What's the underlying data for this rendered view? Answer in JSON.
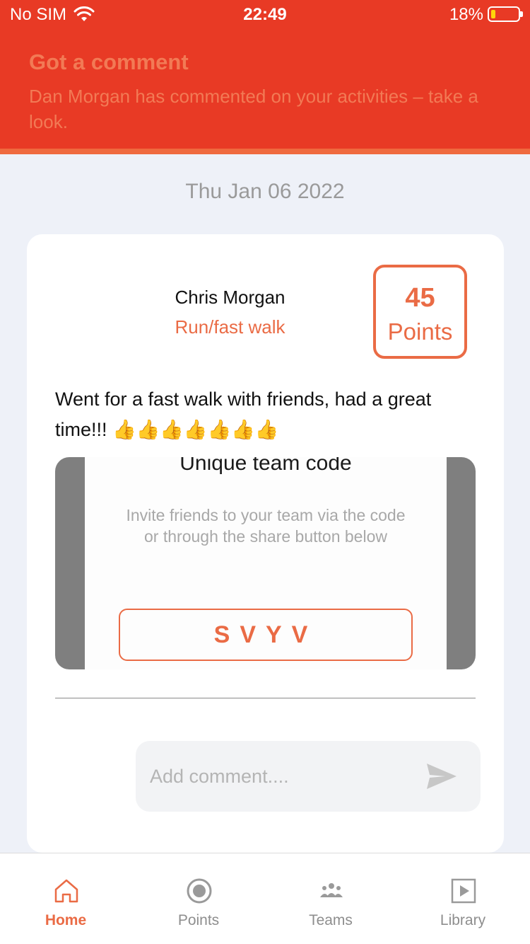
{
  "status_bar": {
    "carrier": "No SIM",
    "time": "22:49",
    "battery_percent": "18%"
  },
  "notification": {
    "title": "Got a comment",
    "body": "Dan Morgan has commented on your activities – take a look."
  },
  "feed": {
    "date": "Thu Jan 06 2022",
    "post": {
      "user_name": "Chris Morgan",
      "activity": "Run/fast walk",
      "points_value": "45",
      "points_label": "Points",
      "text": "Went for a fast walk with friends, had a great time!!! 👍👍👍👍👍👍👍",
      "image": {
        "heading": "Unique team code",
        "description": "Invite friends to your team via the code or through the share button below",
        "code": "SVYV"
      },
      "comment": {
        "placeholder": "Add comment....",
        "value": ""
      }
    }
  },
  "tabs": [
    {
      "label": "Home",
      "icon": "home-icon",
      "active": true
    },
    {
      "label": "Points",
      "icon": "points-icon",
      "active": false
    },
    {
      "label": "Teams",
      "icon": "teams-icon",
      "active": false
    },
    {
      "label": "Library",
      "icon": "library-icon",
      "active": false
    }
  ],
  "colors": {
    "brand_red": "#e83a25",
    "accent_orange": "#ea6b45",
    "background": "#eef1f8"
  }
}
